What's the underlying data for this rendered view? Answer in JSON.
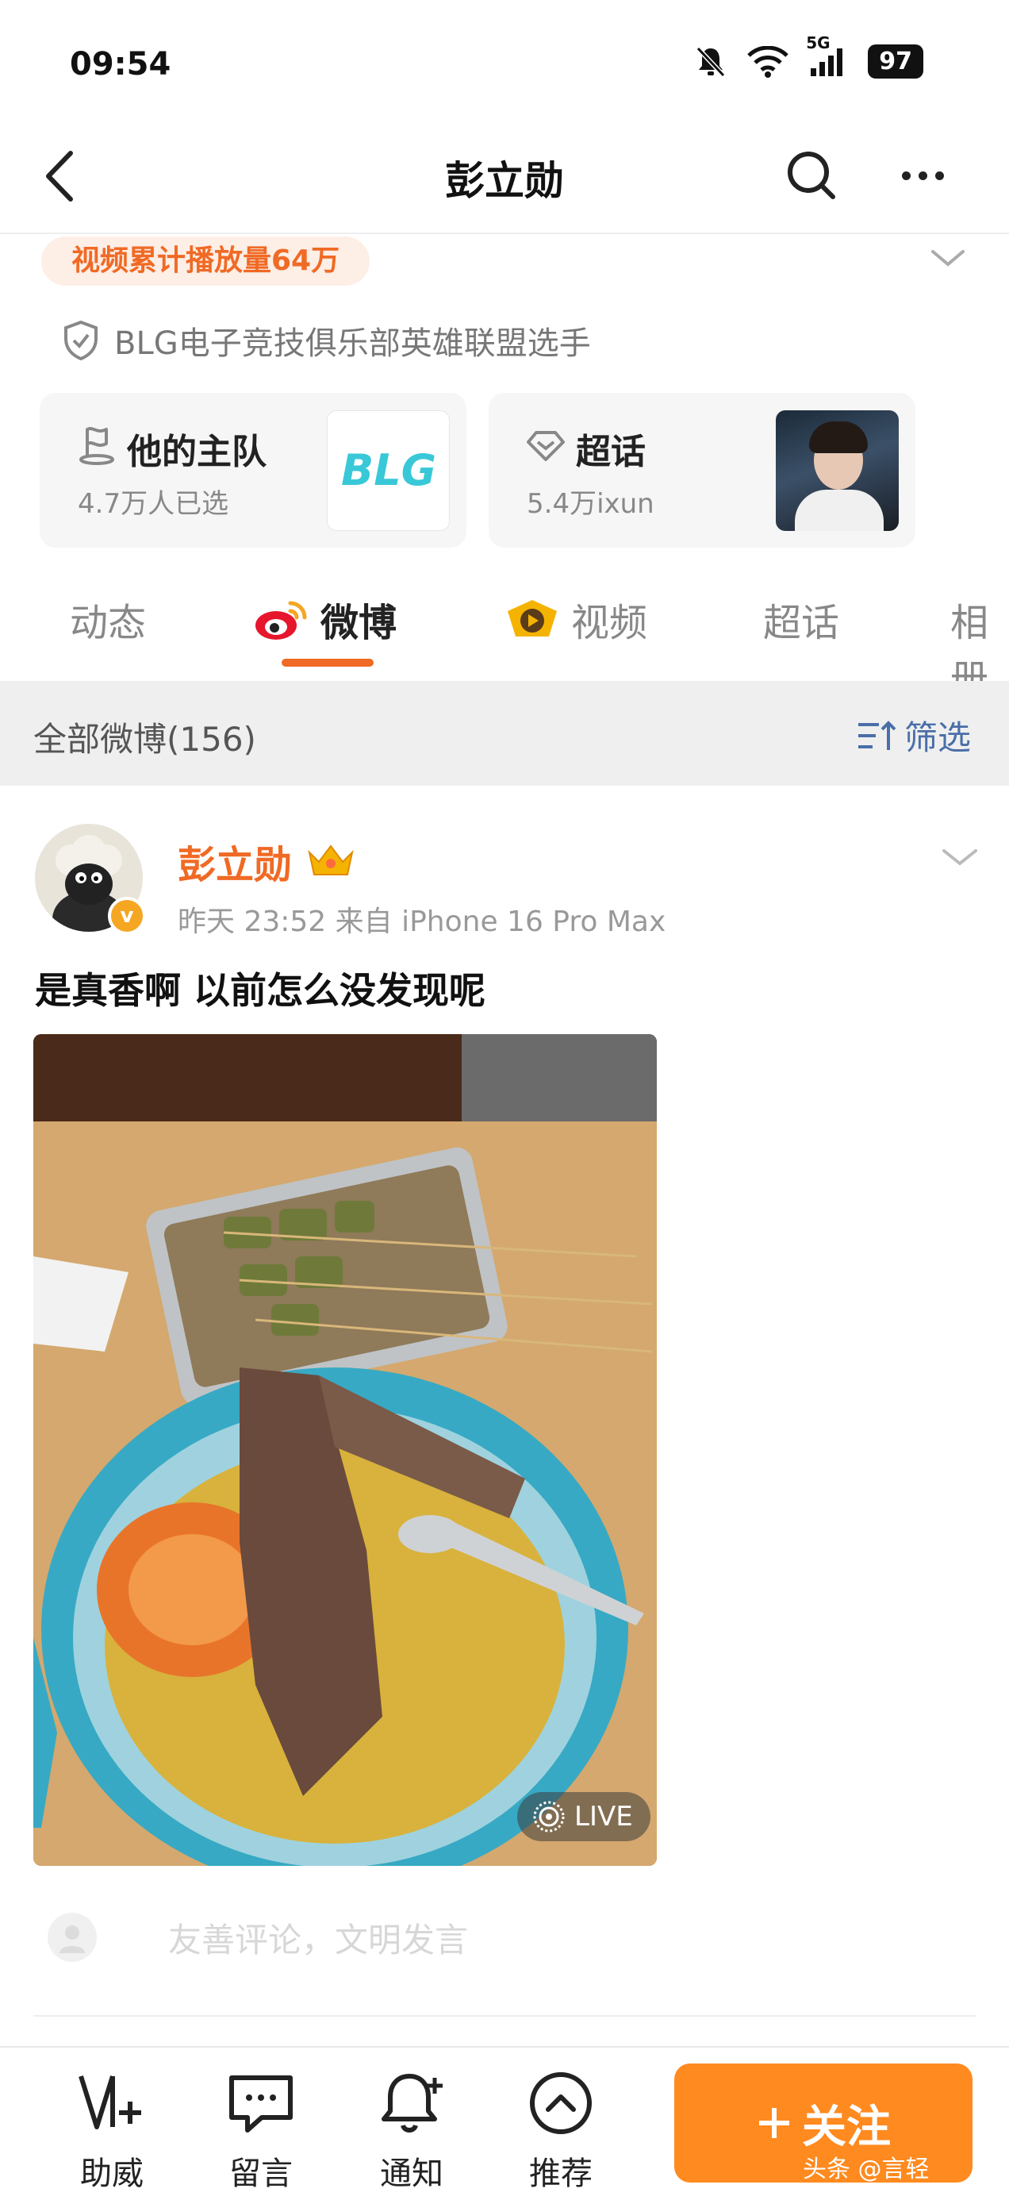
{
  "status_bar": {
    "time": "09:54",
    "battery": "97",
    "network": "5G"
  },
  "nav": {
    "title": "彭立勋"
  },
  "profile": {
    "play_count_badge": "视频累计播放量64万",
    "verification": "BLG电子竞技俱乐部英雄联盟选手",
    "cards": [
      {
        "title": "他的主队",
        "subtitle": "4.7万人已选",
        "thumb_text": "BLG"
      },
      {
        "title": "超话",
        "subtitle": "5.4万ixun"
      }
    ]
  },
  "tabs": [
    {
      "label": "动态",
      "active": false
    },
    {
      "label": "微博",
      "active": true
    },
    {
      "label": "视频",
      "active": false
    },
    {
      "label": "超话",
      "active": false
    },
    {
      "label": "相册",
      "active": false
    }
  ],
  "filter_bar": {
    "count_label": "全部微博(156)",
    "filter_label": "筛选"
  },
  "post": {
    "author": "彭立勋",
    "avatar_badge": "v",
    "meta": "昨天 23:52  来自 iPhone 16 Pro Max",
    "text": "是真香啊  以前怎么没发现呢",
    "live_label": "LIVE",
    "comment_placeholder": "友善评论，文明发言"
  },
  "bottom_bar": {
    "items": [
      {
        "label": "助威",
        "icon": "cheer-icon"
      },
      {
        "label": "留言",
        "icon": "message-icon"
      },
      {
        "label": "通知",
        "icon": "bell-plus-icon"
      },
      {
        "label": "推荐",
        "icon": "chevron-up-circle-icon"
      }
    ],
    "follow_label": "关注",
    "watermark": "头条 @言轻"
  },
  "colors": {
    "accent": "#f06a25",
    "follow": "#ff8a1f",
    "link_blue": "#4a6fa8"
  }
}
